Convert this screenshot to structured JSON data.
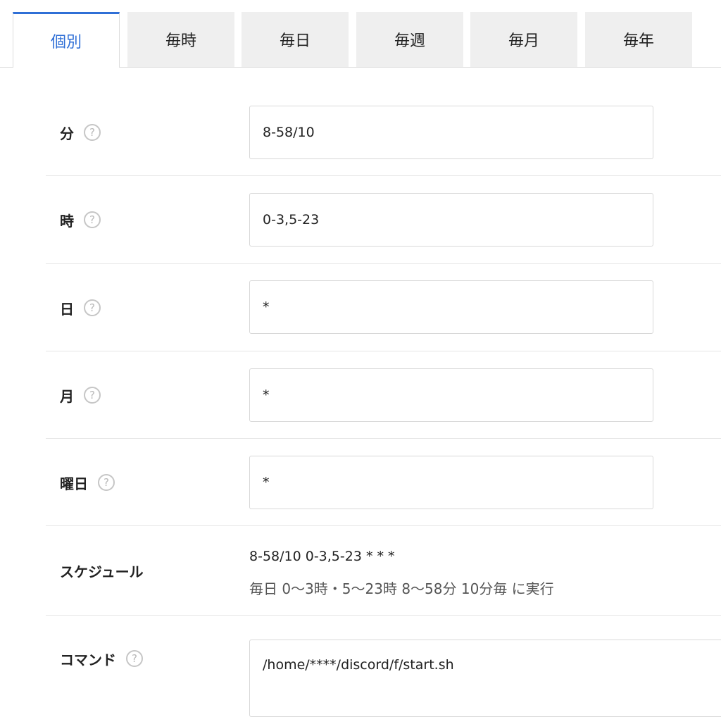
{
  "tabs": [
    {
      "label": "個別",
      "active": true
    },
    {
      "label": "毎時",
      "active": false
    },
    {
      "label": "毎日",
      "active": false
    },
    {
      "label": "毎週",
      "active": false
    },
    {
      "label": "毎月",
      "active": false
    },
    {
      "label": "毎年",
      "active": false
    }
  ],
  "help_glyph": "?",
  "fields": {
    "minute": {
      "label": "分",
      "value": "8-58/10"
    },
    "hour": {
      "label": "時",
      "value": "0-3,5-23"
    },
    "day": {
      "label": "日",
      "value": "*"
    },
    "month": {
      "label": "月",
      "value": "*"
    },
    "weekday": {
      "label": "曜日",
      "value": "*"
    }
  },
  "schedule": {
    "label": "スケジュール",
    "expression": "8-58/10 0-3,5-23 * * *",
    "description": "毎日 0〜3時・5〜23時 8〜58分 10分毎 に実行"
  },
  "command": {
    "label": "コマンド",
    "value": "/home/****/discord/f/start.sh"
  },
  "colors": {
    "accent": "#2f6fd6",
    "tab_bg": "#efefef",
    "border": "#d8d8d8"
  }
}
